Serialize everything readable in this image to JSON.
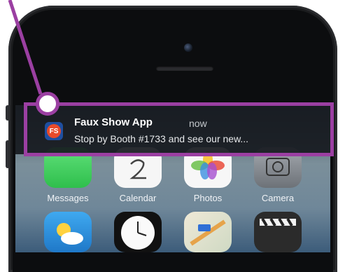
{
  "notification": {
    "app_name": "Faux Show App",
    "time": "now",
    "message": "Stop by Booth #1733 and see our new...",
    "badge": "FS"
  },
  "home_screen": {
    "apps_row1": [
      {
        "label": "Messages",
        "icon": "messages-icon",
        "color": "#4cd964"
      },
      {
        "label": "Calendar",
        "icon": "calendar-icon",
        "color": "#f5f5f5"
      },
      {
        "label": "Photos",
        "icon": "photos-icon",
        "color": "#f4f4f4"
      },
      {
        "label": "Camera",
        "icon": "camera-icon",
        "color": "#8a8f96"
      }
    ],
    "apps_row2": [
      {
        "icon": "weather-icon",
        "color": "#3aa0e8"
      },
      {
        "icon": "clock-icon",
        "color": "#f2f2f2"
      },
      {
        "icon": "maps-icon",
        "color": "#e7e2d2"
      },
      {
        "icon": "videos-icon",
        "color": "#2a2a2a"
      }
    ]
  },
  "accent_color": "#9b3fa2"
}
